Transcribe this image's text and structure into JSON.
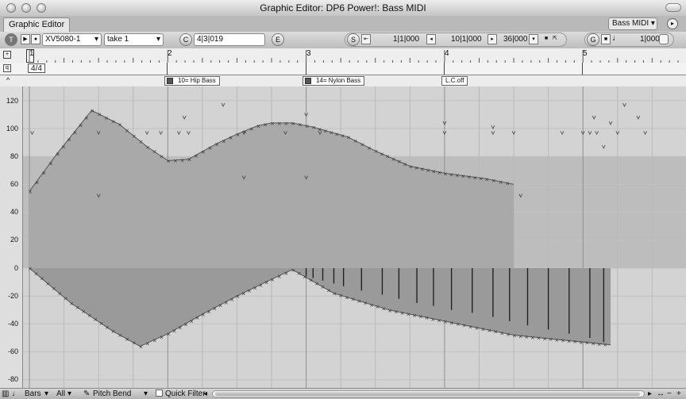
{
  "window": {
    "title": "Graphic Editor: DP6 Power!: Bass MIDI"
  },
  "tabs": [
    {
      "label": "Graphic Editor"
    }
  ],
  "track_menu": {
    "label": "Bass MIDI ▾"
  },
  "toolbar": {
    "t_label": "T",
    "instrument": "XV5080-1",
    "take": "take 1",
    "c_label": "C",
    "counter": "4|3|019",
    "e_label": "E",
    "s_label": "S",
    "start": "1|1|000",
    "end": "10|1|000",
    "duration": "36|000",
    "g_label": "G",
    "grid": "1|000"
  },
  "ruler": {
    "bars": [
      "1",
      "2",
      "3",
      "4",
      "5"
    ]
  },
  "meter": {
    "time_signature": "4/4"
  },
  "events": {
    "patch1": "10= Hip Bass",
    "patch2": "14= Nylon Bass",
    "lc": "L.C.off"
  },
  "y_axis": {
    "labels": [
      "120",
      "100",
      "80",
      "60",
      "40",
      "20",
      "0",
      "-20",
      "-40",
      "-60",
      "-80"
    ]
  },
  "bottom": {
    "bars": "Bars",
    "all": "All",
    "pitch_bend": "Pitch Bend",
    "quick_filter": "Quick Filter"
  },
  "chart_data": {
    "type": "area",
    "ylim": [
      -85,
      127
    ],
    "x_units": "bars",
    "bar_ticks": [
      1,
      2,
      3,
      4,
      5
    ],
    "series": [
      {
        "kind": "controller curve",
        "points": [
          [
            1.0,
            55
          ],
          [
            1.2,
            82
          ],
          [
            1.45,
            113
          ],
          [
            1.65,
            103
          ],
          [
            1.85,
            87
          ],
          [
            2.0,
            77
          ],
          [
            2.15,
            78
          ],
          [
            2.35,
            89
          ],
          [
            2.5,
            96
          ],
          [
            2.65,
            102
          ],
          [
            2.75,
            104
          ],
          [
            2.9,
            104
          ],
          [
            3.05,
            101
          ],
          [
            3.3,
            94
          ],
          [
            3.5,
            84
          ],
          [
            3.75,
            73
          ],
          [
            4.0,
            68
          ],
          [
            4.3,
            64
          ],
          [
            4.5,
            60
          ]
        ]
      },
      {
        "kind": "pitch bend",
        "points": [
          [
            1.0,
            0
          ],
          [
            1.3,
            -25
          ],
          [
            1.6,
            -45
          ],
          [
            1.8,
            -56
          ],
          [
            2.0,
            -47
          ],
          [
            2.25,
            -33
          ],
          [
            2.5,
            -20
          ],
          [
            2.75,
            -8
          ],
          [
            2.9,
            -1
          ],
          [
            3.2,
            -18
          ],
          [
            3.6,
            -30
          ],
          [
            4.0,
            -38
          ],
          [
            4.5,
            -48
          ],
          [
            5.2,
            -55
          ]
        ]
      }
    ],
    "stems": [
      {
        "bar": 3.0,
        "y": -6
      },
      {
        "bar": 3.05,
        "y": -7
      },
      {
        "bar": 3.12,
        "y": -9
      },
      {
        "bar": 3.2,
        "y": -11
      },
      {
        "bar": 3.27,
        "y": -13
      },
      {
        "bar": 3.4,
        "y": -16
      },
      {
        "bar": 3.55,
        "y": -19
      },
      {
        "bar": 3.67,
        "y": -22
      },
      {
        "bar": 3.8,
        "y": -25
      },
      {
        "bar": 3.92,
        "y": -27
      },
      {
        "bar": 4.05,
        "y": -30
      },
      {
        "bar": 4.2,
        "y": -32
      },
      {
        "bar": 4.35,
        "y": -35
      },
      {
        "bar": 4.47,
        "y": -38
      },
      {
        "bar": 4.6,
        "y": -41
      },
      {
        "bar": 4.75,
        "y": -44
      },
      {
        "bar": 4.9,
        "y": -47
      },
      {
        "bar": 5.05,
        "y": -50
      },
      {
        "bar": 5.15,
        "y": -53
      }
    ],
    "note_markers": [
      [
        1.02,
        97
      ],
      [
        1.5,
        97
      ],
      [
        1.5,
        52
      ],
      [
        1.85,
        97
      ],
      [
        1.95,
        97
      ],
      [
        2.08,
        97
      ],
      [
        2.12,
        108
      ],
      [
        2.15,
        97
      ],
      [
        2.4,
        117
      ],
      [
        2.55,
        97
      ],
      [
        2.55,
        65
      ],
      [
        2.85,
        97
      ],
      [
        3.0,
        110
      ],
      [
        3.0,
        65
      ],
      [
        3.1,
        97
      ],
      [
        4.0,
        104
      ],
      [
        4.0,
        97
      ],
      [
        4.35,
        101
      ],
      [
        4.35,
        97
      ],
      [
        4.5,
        97
      ],
      [
        4.55,
        52
      ],
      [
        4.85,
        97
      ],
      [
        5.0,
        97
      ],
      [
        5.05,
        97
      ],
      [
        5.08,
        108
      ],
      [
        5.1,
        97
      ],
      [
        5.15,
        87
      ],
      [
        5.2,
        104
      ],
      [
        5.25,
        97
      ],
      [
        5.3,
        117
      ],
      [
        5.4,
        108
      ],
      [
        5.45,
        97
      ]
    ]
  }
}
